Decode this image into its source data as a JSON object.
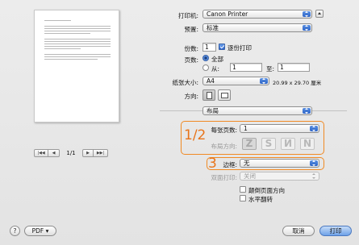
{
  "preview": {
    "page_indicator": "1/1",
    "first_icon": "first-page-icon",
    "prev_icon": "previous-page-icon",
    "next_icon": "next-page-icon",
    "last_icon": "last-page-icon"
  },
  "printer": {
    "label": "打印机:",
    "value": "Canon Printer"
  },
  "presets": {
    "label": "预置:",
    "value": "标准"
  },
  "copies": {
    "label": "份数:",
    "value": "1",
    "collated_label": "逐份打印",
    "collated_checked": true
  },
  "pages": {
    "label": "页数:",
    "all_label": "全部",
    "from_label": "从:",
    "from_value": "1",
    "to_label": "至:",
    "to_value": "1",
    "selected": "all"
  },
  "paper_size": {
    "label": "纸张大小:",
    "value": "A4",
    "dimensions": "20.99 x 29.70 厘米"
  },
  "orientation": {
    "label": "方向:",
    "selected": "portrait"
  },
  "section": {
    "value": "布局"
  },
  "layout": {
    "pages_per_sheet_label": "每张页数:",
    "pages_per_sheet_value": "1",
    "layout_direction_label": "布局方向:",
    "directions": [
      "Z",
      "S",
      "И",
      "N"
    ],
    "border_label": "边框:",
    "border_value": "无",
    "two_sided_label": "双面打印:",
    "two_sided_value": "关闭",
    "reverse_label": "颠倒页面方向",
    "flip_label": "水平翻转"
  },
  "annotations": {
    "label_a": "1/2",
    "label_b": "3",
    "color": "#f08a24"
  },
  "footer": {
    "help_label": "?",
    "pdf_label": "PDF ▾",
    "cancel_label": "取消",
    "print_label": "打印"
  }
}
